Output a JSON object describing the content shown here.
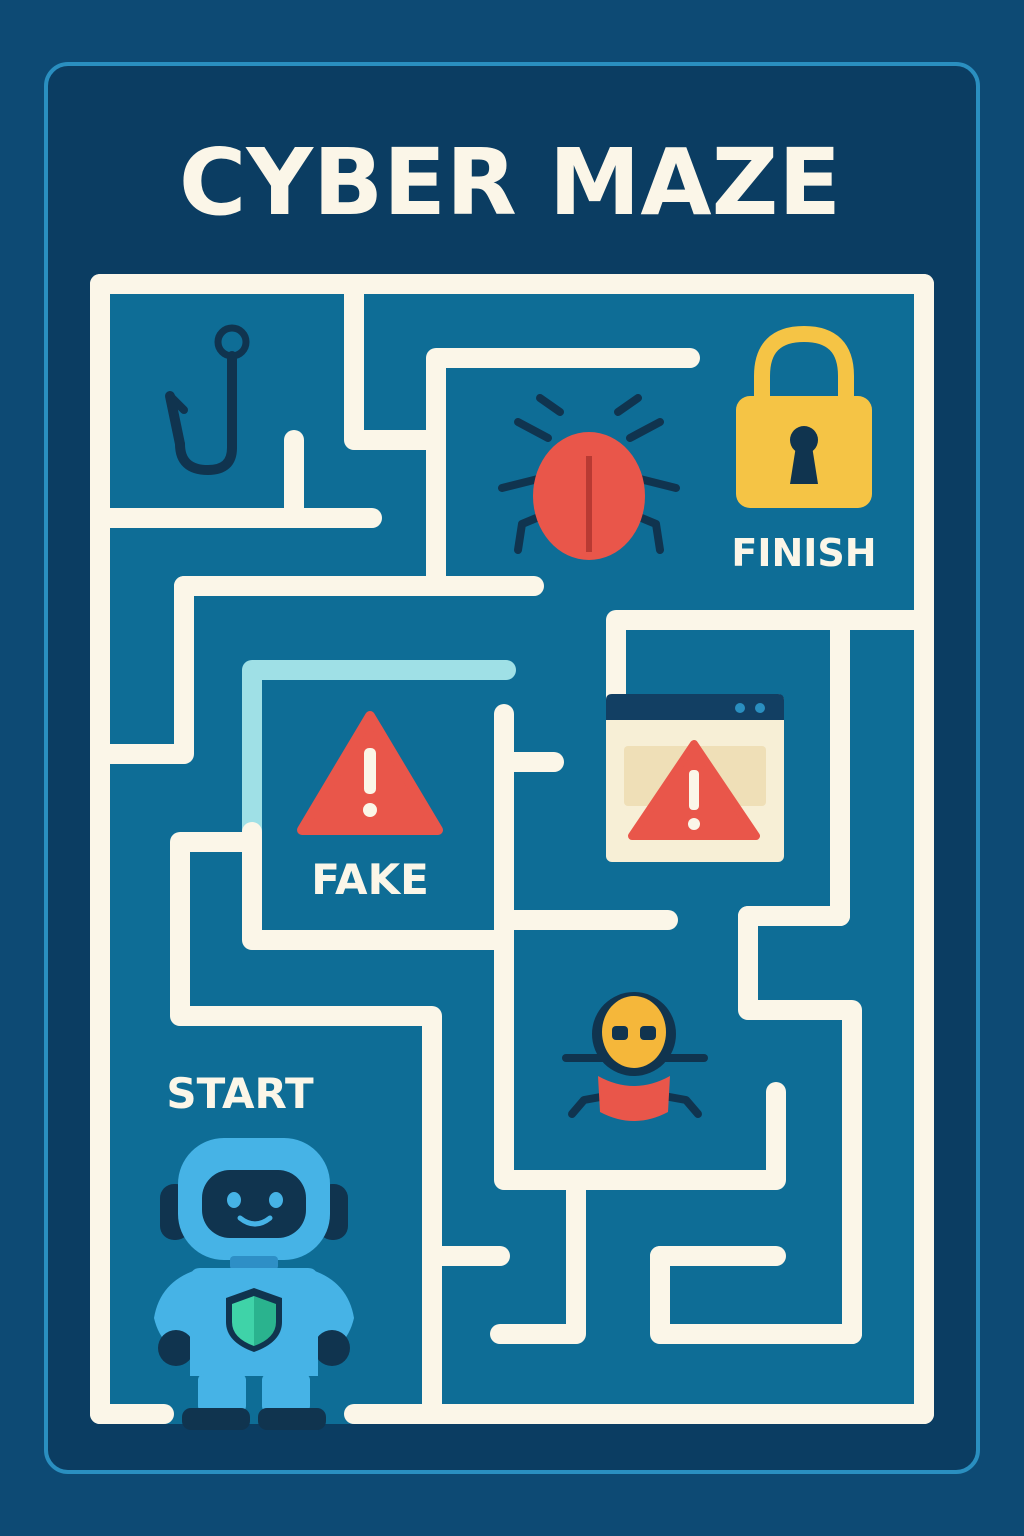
{
  "game": {
    "title": "CYBER MAZE",
    "start_label": "START",
    "finish_label": "FINISH",
    "fake_label": "FAKE"
  },
  "icons": {
    "hook": "fishing-hook-icon",
    "bug": "bug-icon",
    "lock": "padlock-icon",
    "fake_warning": "warning-triangle-icon",
    "popup_warning": "browser-warning-popup-icon",
    "hacker": "masked-hacker-bug-icon",
    "player": "robot-player-icon"
  },
  "colors": {
    "background": "#0d4a74",
    "panel": "#0b3d62",
    "panel_border": "#2a8fc0",
    "maze_floor": "#0e6d96",
    "wall": "#fbf6e8",
    "fake_wall": "#9fe0e6",
    "danger_red": "#e9564a",
    "lock_yellow": "#f5c445",
    "robot_blue": "#46b3e6"
  }
}
